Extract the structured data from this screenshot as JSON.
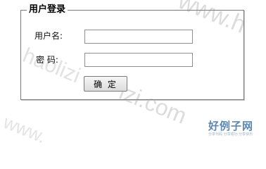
{
  "watermark": {
    "text_1": "www.h",
    "text_2": "haolizi",
    "text_3": "izi.com",
    "text_4": "www."
  },
  "form": {
    "legend": "用户登录",
    "username_label": "用户名:",
    "username_value": "",
    "password_label": "密  码:",
    "password_value": "",
    "submit_label": "确 定"
  },
  "logo": {
    "main_text": "好例子网",
    "sub_text": "分享代码 分享成功 分享快乐"
  }
}
